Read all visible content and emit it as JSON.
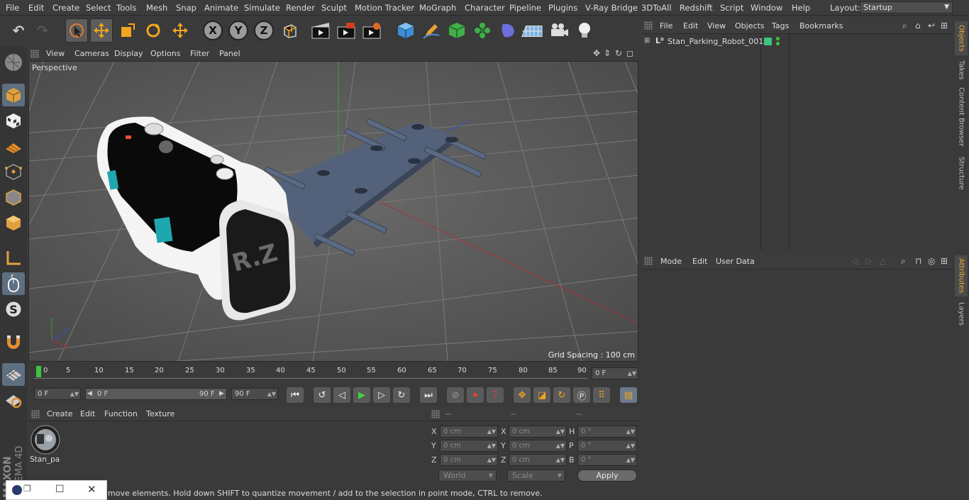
{
  "menubar": {
    "items": [
      "File",
      "Edit",
      "Create",
      "Select",
      "Tools",
      "Mesh",
      "Snap",
      "Animate",
      "Simulate",
      "Render",
      "Sculpt",
      "Motion Tracker",
      "MoGraph",
      "Character",
      "Pipeline",
      "Plugins",
      "V-Ray Bridge",
      "3DToAll",
      "Redshift",
      "Script",
      "Window",
      "Help"
    ],
    "layout_label": "Layout:",
    "layout_value": "Startup"
  },
  "toolbar": {
    "icons": [
      "undo-icon",
      "redo-icon",
      "live-selection-icon",
      "move-icon",
      "scale-icon",
      "rotate-icon",
      "recent-tool-icon",
      "x-axis-icon",
      "y-axis-icon",
      "z-axis-icon",
      "coordinate-system-icon",
      "render-view-icon",
      "render-picture-viewer-icon",
      "edit-render-settings-icon",
      "cube-icon",
      "pen-icon",
      "subdivision-icon",
      "cloner-icon",
      "deformer-icon",
      "floor-icon",
      "camera-icon",
      "light-icon"
    ],
    "axis_labels": [
      "X",
      "Y",
      "Z"
    ]
  },
  "viewport": {
    "menu": [
      "View",
      "Cameras",
      "Display",
      "Options",
      "Filter",
      "Panel"
    ],
    "label": "Perspective",
    "grid_spacing": "Grid Spacing : 100 cm",
    "logo_text": "R.Z"
  },
  "timeline": {
    "ticks": [
      "0",
      "5",
      "10",
      "15",
      "20",
      "25",
      "30",
      "35",
      "40",
      "45",
      "50",
      "55",
      "60",
      "65",
      "70",
      "75",
      "80",
      "85",
      "90"
    ],
    "current": "0 F"
  },
  "transport": {
    "start": "0 F",
    "range_start": "0 F",
    "range_end": "90 F",
    "end": "90 F"
  },
  "material": {
    "menu": [
      "Create",
      "Edit",
      "Function",
      "Texture"
    ],
    "item": "Stan_pa"
  },
  "coords": {
    "headers": [
      "--",
      "--",
      "--"
    ],
    "rows": [
      {
        "a": "X",
        "av": "0 cm",
        "b": "X",
        "bv": "0 cm",
        "c": "H",
        "cv": "0 °"
      },
      {
        "a": "Y",
        "av": "0 cm",
        "b": "Y",
        "bv": "0 cm",
        "c": "P",
        "cv": "0 °"
      },
      {
        "a": "Z",
        "av": "0 cm",
        "b": "Z",
        "bv": "0 cm",
        "c": "B",
        "cv": "0 °"
      }
    ],
    "world": "World",
    "scale": "Scale",
    "apply": "Apply"
  },
  "objects": {
    "menu": [
      "File",
      "Edit",
      "View",
      "Objects",
      "Tags",
      "Bookmarks"
    ],
    "item": "Stan_Parking_Robot_001"
  },
  "attributes": {
    "menu": [
      "Mode",
      "Edit",
      "User Data"
    ]
  },
  "rightstrip": [
    "Objects",
    "Takes",
    "Content Browser",
    "Structure",
    "Attributes",
    "Layers"
  ],
  "status": "move elements. Hold down SHIFT to quantize movement / add to the selection in point mode, CTRL to remove.",
  "brand": {
    "line1": "MAXON",
    "line2": "CINEMA 4D"
  }
}
